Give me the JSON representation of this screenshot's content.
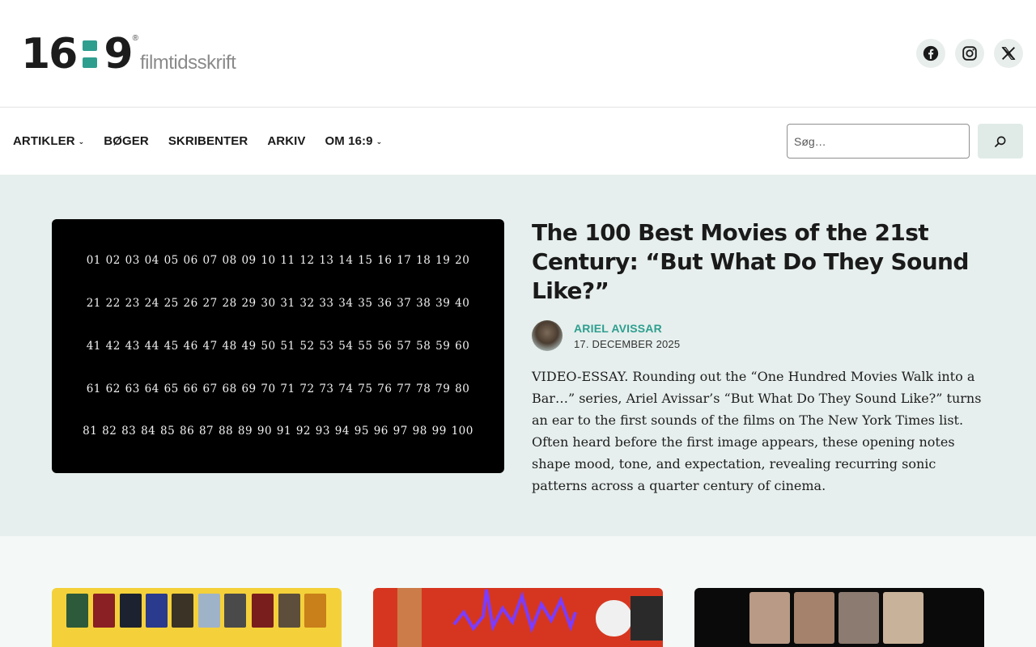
{
  "brand": {
    "logo_mark_left": "16",
    "logo_mark_right": "9",
    "logo_registered": "®",
    "logo_sub": "filmtidsskrift",
    "accent_color": "#2e9e8f"
  },
  "social": [
    {
      "name": "facebook-icon"
    },
    {
      "name": "instagram-icon"
    },
    {
      "name": "x-icon"
    }
  ],
  "nav": {
    "items": [
      {
        "label": "ARTIKLER",
        "has_dropdown": true
      },
      {
        "label": "BØGER",
        "has_dropdown": false
      },
      {
        "label": "SKRIBENTER",
        "has_dropdown": false
      },
      {
        "label": "ARKIV",
        "has_dropdown": false
      },
      {
        "label": "OM 16:9",
        "has_dropdown": true
      }
    ],
    "chevron": "⌄"
  },
  "search": {
    "placeholder": "Søg…",
    "value": ""
  },
  "hero": {
    "number_rows": [
      "01 02 03 04 05 06 07 08 09 10 11 12 13 14 15 16 17 18 19 20",
      "21 22 23 24 25 26 27 28 29 30 31 32 33 34 35 36 37 38 39 40",
      "41 42 43 44 45 46 47 48 49 50 51 52 53 54 55 56 57 58 59 60",
      "61 62 63 64 65 66 67 68 69 70 71 72 73 74 75 76 77 78 79 80",
      "81 82 83 84 85 86 87 88 89 90 91 92 93 94 95 96 97 98 99 100"
    ],
    "title": "The 100 Best Movies of the 21st Century: “But What Do They Sound Like?”",
    "author": "ARIEL AVISSAR",
    "date": "17. DECEMBER 2025",
    "excerpt": "VIDEO-ESSAY. Rounding out the “One Hundred Movies Walk into a Bar…” series, Ariel Avissar’s “But What Do They Sound Like?” turns an ear to the first sounds of the films on The New York Times list. Often heard before the first image appears, these opening notes shape mood, tone, and expectation, revealing recurring sonic patterns across a quarter century of cinema."
  }
}
